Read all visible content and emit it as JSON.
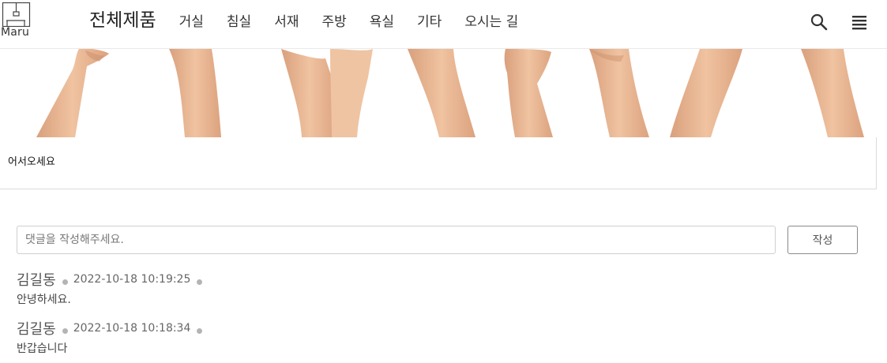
{
  "header": {
    "logo_text": "Maru",
    "nav_title": "전체제품",
    "nav_items": [
      "거실",
      "침실",
      "서재",
      "주방",
      "욕실",
      "기타",
      "오시는 길"
    ]
  },
  "post": {
    "body": "어서오세요"
  },
  "comment_form": {
    "placeholder": "댓글을 작성해주세요.",
    "submit_label": "작성"
  },
  "comments": [
    {
      "author": "김길동",
      "date": "2022-10-18 10:19:25",
      "text": "안녕하세요."
    },
    {
      "author": "김길동",
      "date": "2022-10-18 10:18:34",
      "text": "반갑습니다"
    }
  ],
  "colors": {
    "skin": "#e8b48f",
    "skin_shadow": "#d29c78",
    "border": "#dcdcdc"
  }
}
